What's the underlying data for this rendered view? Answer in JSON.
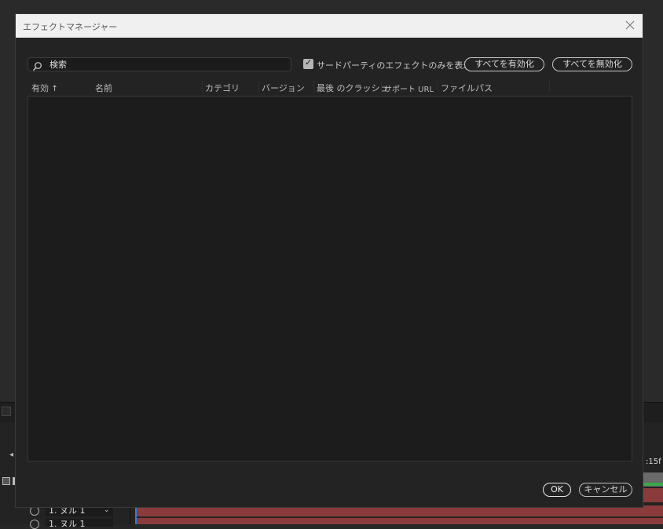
{
  "dialog": {
    "title": "エフェクトマネージャー",
    "search_placeholder": "検索",
    "third_party_checkbox_label": "サードパーティのエフェクトのみを表示",
    "third_party_checked": true,
    "enable_all_label": "すべてを有効化",
    "disable_all_label": "すべてを無効化",
    "columns": [
      "有効",
      "名前",
      "カテゴリ",
      "バージョン",
      "最後 のクラッシュ",
      "サポート URL",
      "ファイルパス"
    ],
    "sort_indicator": "↑",
    "ok_label": "OK",
    "cancel_label": "キャンセル"
  },
  "background": {
    "timecode_fragment": ":15f",
    "layer_1_label": "1. ヌル 1",
    "layer_2_label": "1. ヌル 1",
    "layer_bar_color": "#8b3b3b",
    "cti_color": "#2d7de0"
  },
  "icons": {
    "close": "close-icon",
    "search": "search-icon",
    "checkbox": "checkmark-icon",
    "sort": "sort-up-arrow-icon"
  }
}
